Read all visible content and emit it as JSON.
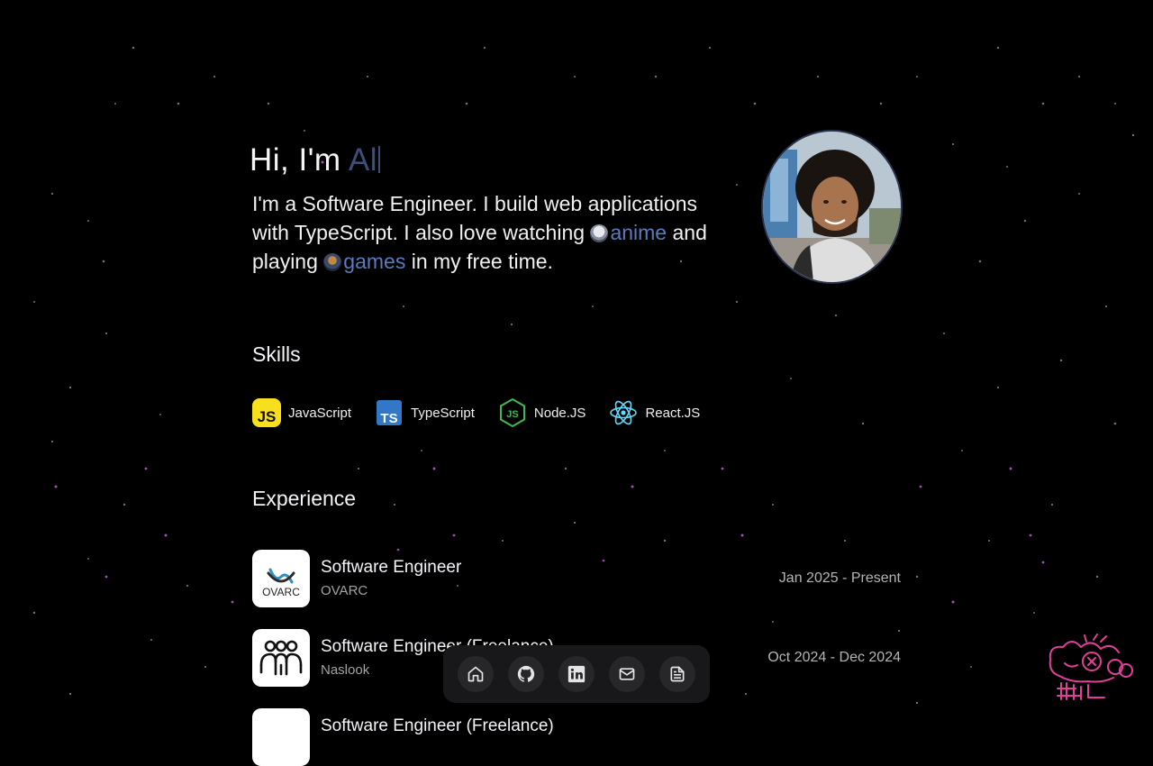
{
  "hero": {
    "greeting": "Hi, I'm ",
    "typed_name": "Al"
  },
  "bio": {
    "text_1": "I'm a Software Engineer. I build web applications with TypeScript. I also love watching ",
    "anime_link": "anime",
    "text_2": " and playing ",
    "games_link": "games",
    "text_3": " in my free time."
  },
  "skills": {
    "title": "Skills",
    "items": [
      {
        "label": "JavaScript",
        "icon": "javascript-icon"
      },
      {
        "label": "TypeScript",
        "icon": "typescript-icon"
      },
      {
        "label": "Node.JS",
        "icon": "nodejs-icon"
      },
      {
        "label": "React.JS",
        "icon": "react-icon"
      }
    ]
  },
  "experience": {
    "title": "Experience",
    "items": [
      {
        "role": "Software Engineer",
        "company": "OVARC",
        "date": "Jan 2025 - Present",
        "logo_text": "OVARC"
      },
      {
        "role": "Software Engineer (Freelance)",
        "company": "Naslook",
        "date": "Oct 2024 - Dec 2024"
      },
      {
        "role": "Software Engineer (Freelance)",
        "company": "",
        "date": ""
      }
    ]
  },
  "dock": {
    "items": [
      {
        "icon": "home-icon"
      },
      {
        "icon": "github-icon"
      },
      {
        "icon": "linkedin-icon"
      },
      {
        "icon": "mail-icon"
      },
      {
        "icon": "resume-icon"
      }
    ]
  },
  "colors": {
    "background": "#000000",
    "accent": "#5b7bbf",
    "typed_text": "#3b4f7a",
    "dock_bg": "#18181b",
    "mascot": "#e0409a"
  }
}
